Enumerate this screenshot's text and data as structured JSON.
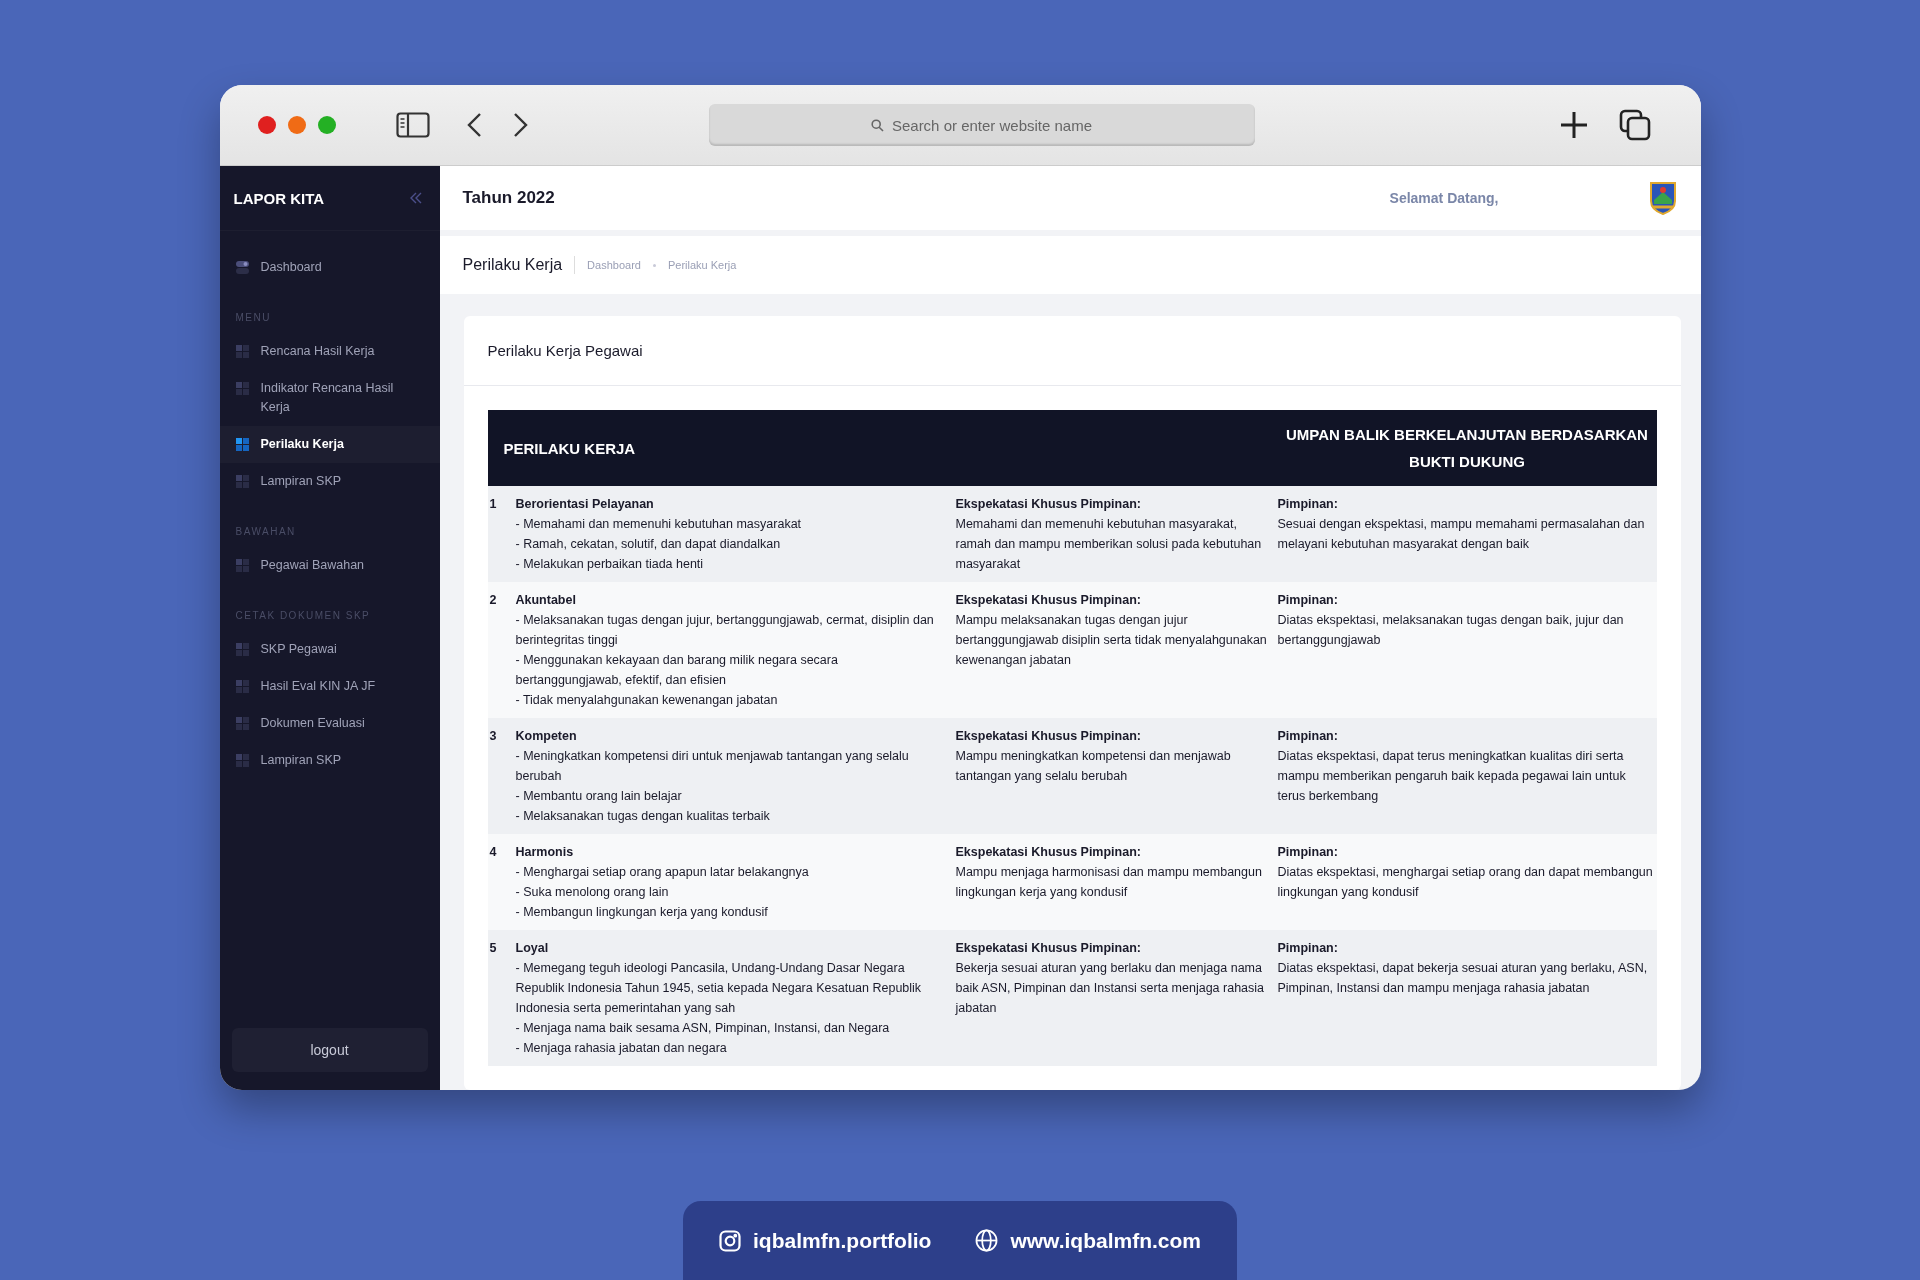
{
  "browser": {
    "search_placeholder": "Search or enter website name"
  },
  "sidebar": {
    "brand": "LAPOR KITA",
    "sections": [
      {
        "items": [
          {
            "label": "Dashboard",
            "kind": "toggle",
            "selected": false
          }
        ]
      },
      {
        "heading": "MENU",
        "items": [
          {
            "label": "Rencana Hasil Kerja",
            "kind": "grid",
            "selected": false
          },
          {
            "label": "Indikator Rencana Hasil Kerja",
            "kind": "grid",
            "selected": false
          },
          {
            "label": "Perilaku Kerja",
            "kind": "grid",
            "selected": true
          },
          {
            "label": "Lampiran SKP",
            "kind": "grid",
            "selected": false
          }
        ]
      },
      {
        "heading": "BAWAHAN",
        "items": [
          {
            "label": "Pegawai Bawahan",
            "kind": "grid",
            "selected": false
          }
        ]
      },
      {
        "heading": "CETAK DOKUMEN SKP",
        "items": [
          {
            "label": "SKP Pegawai",
            "kind": "grid",
            "selected": false
          },
          {
            "label": "Hasil Eval KIN JA JF",
            "kind": "grid",
            "selected": false
          },
          {
            "label": "Dokumen Evaluasi",
            "kind": "grid",
            "selected": false
          },
          {
            "label": "Lampiran SKP",
            "kind": "grid",
            "selected": false
          }
        ]
      }
    ],
    "logout": "logout"
  },
  "header": {
    "title": "Tahun 2022",
    "greeting": "Selamat Datang,"
  },
  "breadcrumb": {
    "title": "Perilaku Kerja",
    "trail": [
      "Dashboard",
      "Perilaku Kerja"
    ]
  },
  "card": {
    "title": "Perilaku Kerja Pegawai",
    "columns": [
      {
        "label": "PERILAKU KERJA"
      },
      {
        "label": "UMPAN BALIK BERKELANJUTAN BERDASARKAN BUKTI DUKUNG"
      }
    ],
    "rows": [
      {
        "number": "1",
        "title": "Berorientasi Pelayanan",
        "points": [
          "- Memahami dan memenuhi kebutuhan masyarakat",
          "- Ramah, cekatan, solutif, dan dapat diandalkan",
          "- Melakukan perbaikan tiada henti"
        ],
        "expectation_label": "Ekspekatasi Khusus Pimpinan:",
        "expectation": "Memahami dan memenuhi kebutuhan masyarakat, ramah dan mampu memberikan solusi pada kebutuhan masyarakat",
        "feedback_label": "Pimpinan:",
        "feedback": "Sesuai dengan ekspektasi, mampu memahami permasalahan dan melayani kebutuhan masyarakat dengan baik"
      },
      {
        "number": "2",
        "title": "Akuntabel",
        "points": [
          "- Melaksanakan tugas dengan jujur, bertanggungjawab, cermat, disiplin dan berintegritas tinggi",
          "- Menggunakan kekayaan dan barang milik negara secara bertanggungjawab, efektif, dan efisien",
          "- Tidak menyalahgunakan kewenangan jabatan"
        ],
        "expectation_label": "Ekspekatasi Khusus Pimpinan:",
        "expectation": "Mampu melaksanakan tugas dengan jujur bertanggungjawab disiplin serta tidak menyalahgunakan kewenangan jabatan",
        "feedback_label": "Pimpinan:",
        "feedback": "Diatas ekspektasi, melaksanakan tugas dengan baik, jujur dan bertanggungjawab"
      },
      {
        "number": "3",
        "title": "Kompeten",
        "points": [
          "- Meningkatkan kompetensi diri untuk menjawab tantangan yang selalu berubah",
          "- Membantu orang lain belajar",
          "- Melaksanakan tugas dengan kualitas terbaik"
        ],
        "expectation_label": "Ekspekatasi Khusus Pimpinan:",
        "expectation": "Mampu meningkatkan kompetensi dan menjawab tantangan yang selalu berubah",
        "feedback_label": "Pimpinan:",
        "feedback": "Diatas ekspektasi, dapat terus meningkatkan kualitas diri serta mampu memberikan pengaruh baik kepada pegawai lain untuk terus berkembang"
      },
      {
        "number": "4",
        "title": "Harmonis",
        "points": [
          "- Menghargai setiap orang apapun latar belakangnya",
          "- Suka menolong orang lain",
          "- Membangun lingkungan kerja yang kondusif"
        ],
        "expectation_label": "Ekspekatasi Khusus Pimpinan:",
        "expectation": "Mampu menjaga harmonisasi dan mampu membangun lingkungan kerja yang kondusif",
        "feedback_label": "Pimpinan:",
        "feedback": "Diatas ekspektasi, menghargai setiap orang dan dapat membangun lingkungan yang kondusif"
      },
      {
        "number": "5",
        "title": "Loyal",
        "points": [
          "- Memegang teguh ideologi Pancasila, Undang-Undang Dasar Negara Republik Indonesia Tahun 1945, setia kepada Negara Kesatuan Republik Indonesia serta pemerintahan yang sah",
          "- Menjaga nama baik sesama ASN, Pimpinan, Instansi, dan Negara",
          "- Menjaga rahasia jabatan dan negara"
        ],
        "expectation_label": "Ekspekatasi Khusus Pimpinan:",
        "expectation": "Bekerja sesuai aturan yang berlaku dan menjaga nama baik ASN, Pimpinan dan Instansi serta menjaga rahasia jabatan",
        "feedback_label": "Pimpinan:",
        "feedback": "Diatas ekspektasi, dapat bekerja sesuai aturan yang berlaku, ASN, Pimpinan, Instansi dan mampu menjaga rahasia jabatan"
      }
    ]
  },
  "credits": [
    {
      "kind": "instagram",
      "text": "iqbalmfn.portfolio"
    },
    {
      "kind": "web",
      "text": "www.iqbalmfn.com"
    }
  ]
}
